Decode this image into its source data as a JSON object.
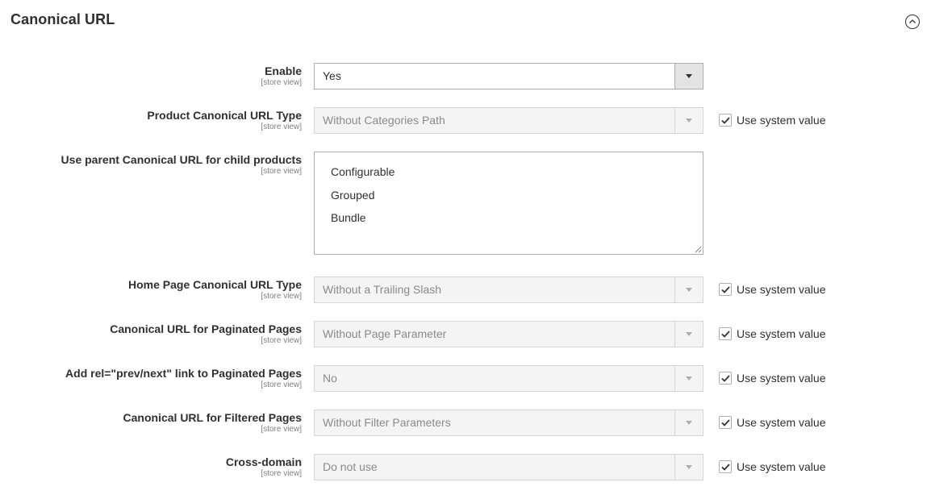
{
  "section": {
    "title": "Canonical URL"
  },
  "scope_label": "[store view]",
  "system_value_label": "Use system value",
  "fields": {
    "enable": {
      "label": "Enable",
      "value": "Yes"
    },
    "product_type": {
      "label": "Product Canonical URL Type",
      "value": "Without Categories Path"
    },
    "parent_child": {
      "label": "Use parent Canonical URL for child products",
      "options": [
        "Configurable",
        "Grouped",
        "Bundle"
      ]
    },
    "home_type": {
      "label": "Home Page Canonical URL Type",
      "value": "Without a Trailing Slash"
    },
    "paginated": {
      "label": "Canonical URL for Paginated Pages",
      "value": "Without Page Parameter"
    },
    "prev_next": {
      "label": "Add rel=\"prev/next\" link to Paginated Pages",
      "value": "No"
    },
    "filtered": {
      "label": "Canonical URL for Filtered Pages",
      "value": "Without Filter Parameters"
    },
    "cross_domain": {
      "label": "Cross-domain",
      "value": "Do not use"
    }
  }
}
